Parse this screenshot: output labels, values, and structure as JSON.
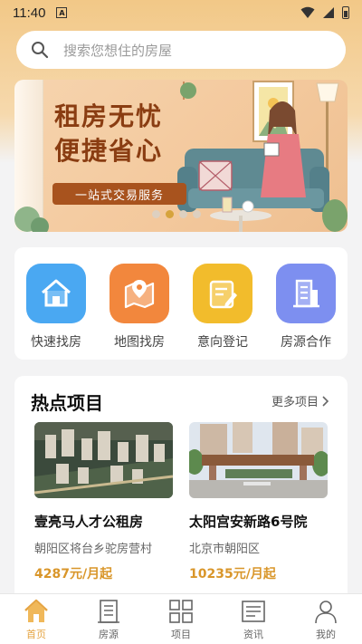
{
  "status_bar": {
    "time": "11:40",
    "notif_letter": "A"
  },
  "search": {
    "placeholder": "搜索您想住的房屋"
  },
  "banner": {
    "title_line1": "租房无忧",
    "title_line2": "便捷省心",
    "tag": "一站式交易服务",
    "dots": 4,
    "active_dot": 1
  },
  "quick_actions": [
    {
      "label": "快速找房",
      "icon": "home-icon",
      "color": "#4aa8f2"
    },
    {
      "label": "地图找房",
      "icon": "map-icon",
      "color": "#f2873d"
    },
    {
      "label": "意向登记",
      "icon": "edit-note-icon",
      "color": "#f2bc2c"
    },
    {
      "label": "房源合作",
      "icon": "building-icon",
      "color": "#7d8ff0"
    }
  ],
  "hot": {
    "title": "热点项目",
    "more": "更多项目",
    "projects": [
      {
        "name": "壹亮马人才公租房",
        "address": "朝阳区将台乡驼房营村",
        "price": "4287元/月起"
      },
      {
        "name": "太阳宫安新路6号院",
        "address": "北京市朝阳区",
        "price": "10235元/月起"
      }
    ]
  },
  "tabbar": {
    "active": 0,
    "items": [
      {
        "label": "首页",
        "icon": "home-tab-icon"
      },
      {
        "label": "房源",
        "icon": "listing-tab-icon"
      },
      {
        "label": "项目",
        "icon": "grid-tab-icon"
      },
      {
        "label": "资讯",
        "icon": "news-tab-icon"
      },
      {
        "label": "我的",
        "icon": "profile-tab-icon"
      }
    ]
  },
  "colors": {
    "accent": "#e5a443",
    "price": "#d9962a",
    "banner_text": "#8a3d12"
  }
}
